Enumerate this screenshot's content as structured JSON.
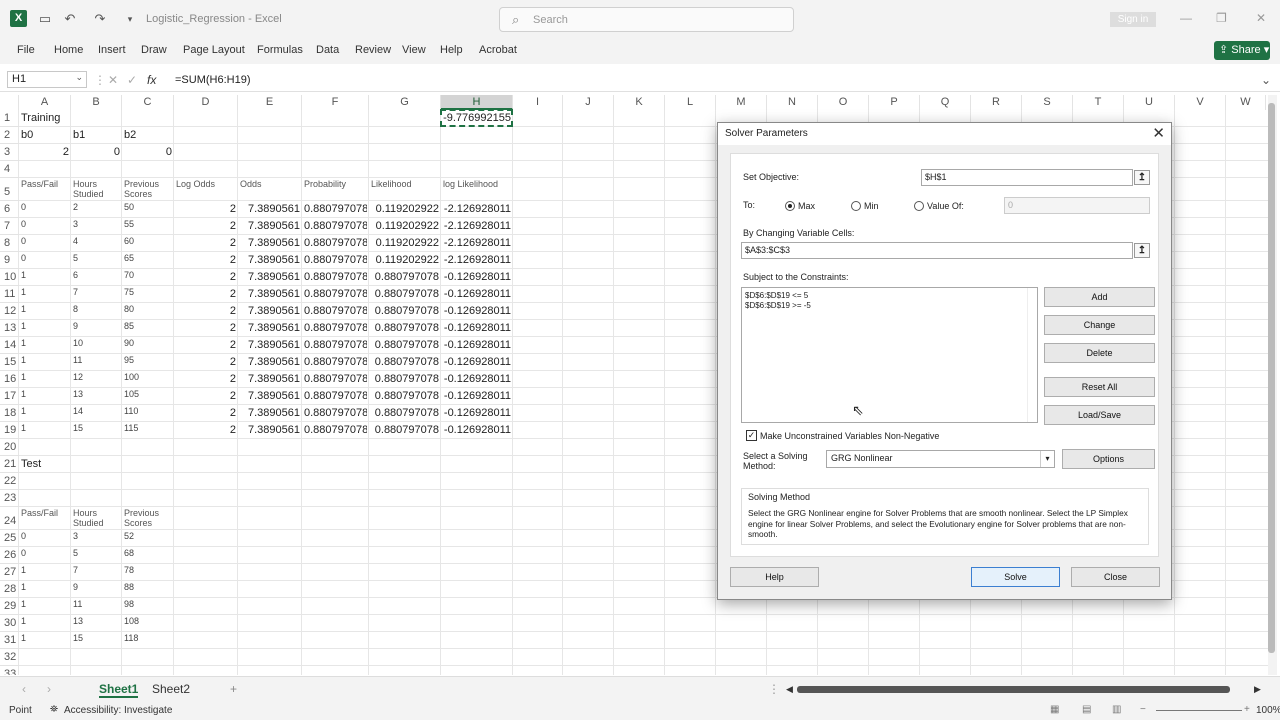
{
  "titlebar": {
    "doc_title": "Logistic_Regression  -  Excel",
    "search_placeholder": "Search",
    "signin": "Sign in",
    "app_letter": "X"
  },
  "menu": [
    "File",
    "Home",
    "Insert",
    "Draw",
    "Page Layout",
    "Formulas",
    "Data",
    "Review",
    "View",
    "Help",
    "Acrobat"
  ],
  "share_label": "Share",
  "formula_bar": {
    "name_box": "H1",
    "fx": "fx",
    "formula": "=SUM(H6:H19)"
  },
  "columns": [
    "A",
    "B",
    "C",
    "D",
    "E",
    "F",
    "G",
    "H",
    "I",
    "J",
    "K",
    "L",
    "M",
    "N",
    "O",
    "P",
    "Q",
    "R",
    "S",
    "T",
    "U",
    "V",
    "W"
  ],
  "selected_column": "H",
  "rows": [
    "1",
    "2",
    "3",
    "4",
    "5",
    "6",
    "7",
    "8",
    "9",
    "10",
    "11",
    "12",
    "13",
    "14",
    "15",
    "16",
    "17",
    "18",
    "19",
    "20",
    "21",
    "22",
    "23",
    "24",
    "25",
    "26",
    "27",
    "28",
    "29",
    "30",
    "31",
    "32",
    "33"
  ],
  "cells": {
    "A1": "Training",
    "H1": "-9.776992155",
    "A2": "b0",
    "B2": "b1",
    "C2": "b2",
    "A3": "2",
    "B3": "0",
    "C3": "0",
    "hdr_pass": "Pass/Fail",
    "hdr_hours": "Hours Studied",
    "hdr_prev": "Previous Scores",
    "hdr_logodds": "Log Odds",
    "hdr_odds": "Odds",
    "hdr_prob": "Probability",
    "hdr_like": "Likelihood",
    "hdr_loglike": "log Likelihood",
    "A21": "Test"
  },
  "training_rows": [
    {
      "pf": "0",
      "hours": "2",
      "prev": "50",
      "lo": "2",
      "odds": "7.3890561",
      "prob": "0.880797078",
      "lik": "0.119202922",
      "ll": "-2.126928011"
    },
    {
      "pf": "0",
      "hours": "3",
      "prev": "55",
      "lo": "2",
      "odds": "7.3890561",
      "prob": "0.880797078",
      "lik": "0.119202922",
      "ll": "-2.126928011"
    },
    {
      "pf": "0",
      "hours": "4",
      "prev": "60",
      "lo": "2",
      "odds": "7.3890561",
      "prob": "0.880797078",
      "lik": "0.119202922",
      "ll": "-2.126928011"
    },
    {
      "pf": "0",
      "hours": "5",
      "prev": "65",
      "lo": "2",
      "odds": "7.3890561",
      "prob": "0.880797078",
      "lik": "0.119202922",
      "ll": "-2.126928011"
    },
    {
      "pf": "1",
      "hours": "6",
      "prev": "70",
      "lo": "2",
      "odds": "7.3890561",
      "prob": "0.880797078",
      "lik": "0.880797078",
      "ll": "-0.126928011"
    },
    {
      "pf": "1",
      "hours": "7",
      "prev": "75",
      "lo": "2",
      "odds": "7.3890561",
      "prob": "0.880797078",
      "lik": "0.880797078",
      "ll": "-0.126928011"
    },
    {
      "pf": "1",
      "hours": "8",
      "prev": "80",
      "lo": "2",
      "odds": "7.3890561",
      "prob": "0.880797078",
      "lik": "0.880797078",
      "ll": "-0.126928011"
    },
    {
      "pf": "1",
      "hours": "9",
      "prev": "85",
      "lo": "2",
      "odds": "7.3890561",
      "prob": "0.880797078",
      "lik": "0.880797078",
      "ll": "-0.126928011"
    },
    {
      "pf": "1",
      "hours": "10",
      "prev": "90",
      "lo": "2",
      "odds": "7.3890561",
      "prob": "0.880797078",
      "lik": "0.880797078",
      "ll": "-0.126928011"
    },
    {
      "pf": "1",
      "hours": "11",
      "prev": "95",
      "lo": "2",
      "odds": "7.3890561",
      "prob": "0.880797078",
      "lik": "0.880797078",
      "ll": "-0.126928011"
    },
    {
      "pf": "1",
      "hours": "12",
      "prev": "100",
      "lo": "2",
      "odds": "7.3890561",
      "prob": "0.880797078",
      "lik": "0.880797078",
      "ll": "-0.126928011"
    },
    {
      "pf": "1",
      "hours": "13",
      "prev": "105",
      "lo": "2",
      "odds": "7.3890561",
      "prob": "0.880797078",
      "lik": "0.880797078",
      "ll": "-0.126928011"
    },
    {
      "pf": "1",
      "hours": "14",
      "prev": "110",
      "lo": "2",
      "odds": "7.3890561",
      "prob": "0.880797078",
      "lik": "0.880797078",
      "ll": "-0.126928011"
    },
    {
      "pf": "1",
      "hours": "15",
      "prev": "115",
      "lo": "2",
      "odds": "7.3890561",
      "prob": "0.880797078",
      "lik": "0.880797078",
      "ll": "-0.126928011"
    }
  ],
  "test_rows": [
    {
      "pf": "0",
      "hours": "3",
      "prev": "52"
    },
    {
      "pf": "0",
      "hours": "5",
      "prev": "68"
    },
    {
      "pf": "1",
      "hours": "7",
      "prev": "78"
    },
    {
      "pf": "1",
      "hours": "9",
      "prev": "88"
    },
    {
      "pf": "1",
      "hours": "11",
      "prev": "98"
    },
    {
      "pf": "1",
      "hours": "13",
      "prev": "108"
    },
    {
      "pf": "1",
      "hours": "15",
      "prev": "118"
    }
  ],
  "sheets": {
    "sheet1": "Sheet1",
    "sheet2": "Sheet2",
    "add": "+"
  },
  "status": {
    "mode": "Point",
    "accessibility": "Accessibility: Investigate",
    "zoom": "100%"
  },
  "dialog": {
    "title": "Solver Parameters",
    "set_objective_label": "Set Objective:",
    "objective_value": "$H$1",
    "to_label": "To:",
    "max_label": "Max",
    "min_label": "Min",
    "valueof_label": "Value Of:",
    "valueof_value": "0",
    "selected_goal": "Max",
    "changing_label": "By Changing Variable Cells:",
    "changing_value": "$A$3:$C$3",
    "subject_label": "Subject to the Constraints:",
    "constraints": [
      "$D$6:$D$19 <= 5",
      "$D$6:$D$19 >= -5"
    ],
    "btn_add": "Add",
    "btn_change": "Change",
    "btn_delete": "Delete",
    "btn_reset": "Reset All",
    "btn_loadsave": "Load/Save",
    "nonneg_label": "Make Unconstrained Variables Non-Negative",
    "nonneg_checked": true,
    "method_label": "Select a Solving Method:",
    "method_value": "GRG Nonlinear",
    "btn_options": "Options",
    "solving_method_title": "Solving Method",
    "solving_method_desc": "Select the GRG Nonlinear engine for Solver Problems that are smooth nonlinear. Select the LP Simplex engine for linear Solver Problems, and select the Evolutionary engine for Solver problems that are non-smooth.",
    "btn_help": "Help",
    "btn_solve": "Solve",
    "btn_close": "Close"
  }
}
